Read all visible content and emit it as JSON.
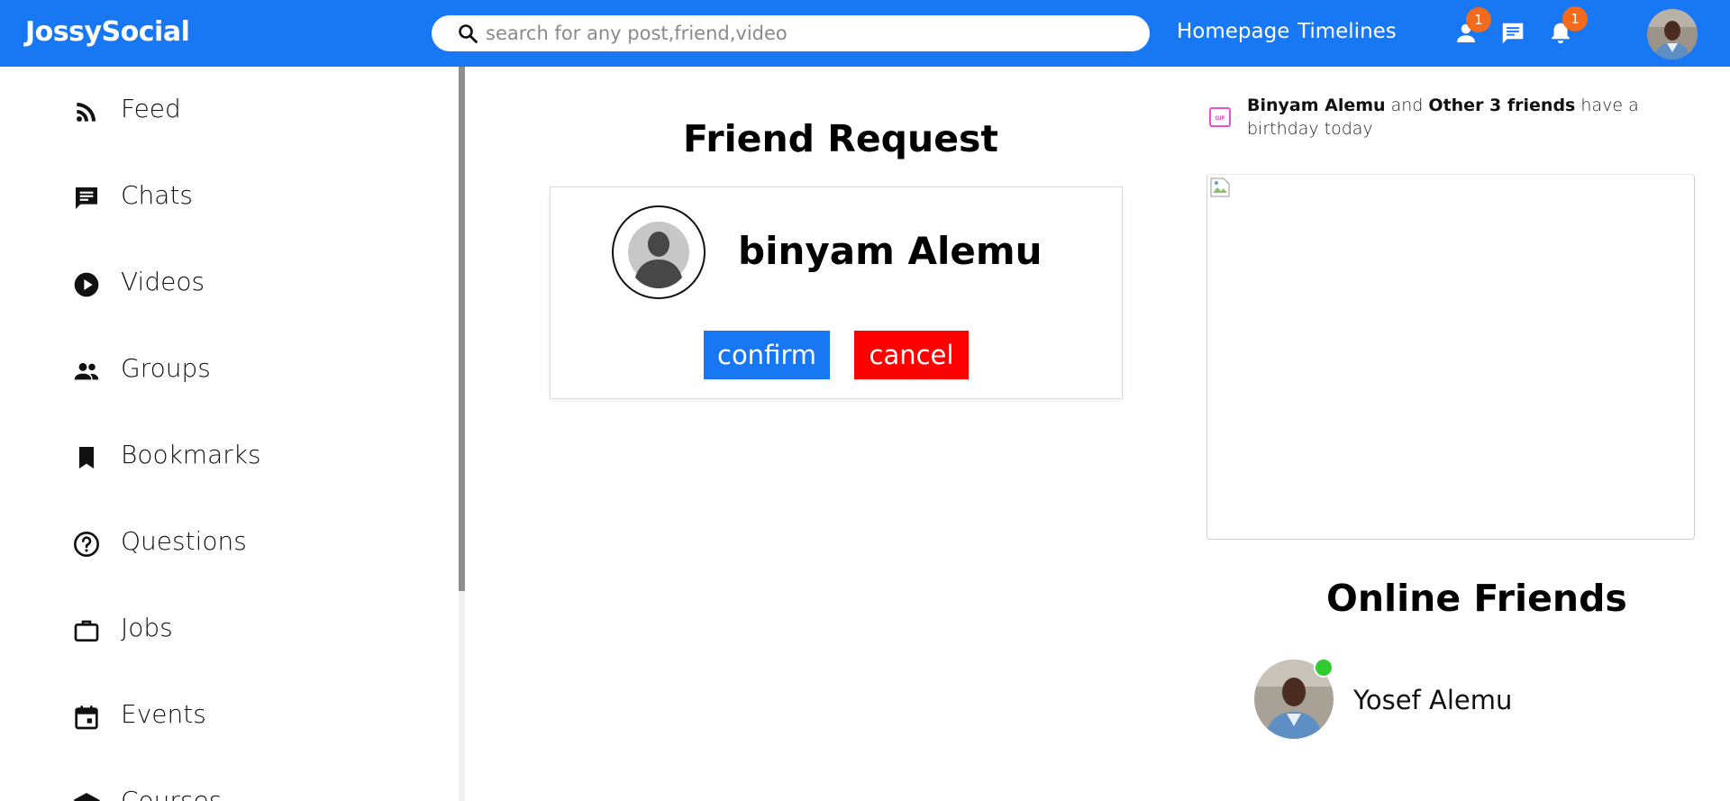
{
  "header": {
    "logo": "JossySocial",
    "search_placeholder": "search for any post,friend,video",
    "links": [
      "Homepage",
      "Timelines"
    ],
    "friend_badge": "1",
    "notification_badge": "1"
  },
  "sidebar": {
    "items": [
      {
        "label": "Feed",
        "icon": "rss-icon"
      },
      {
        "label": "Chats",
        "icon": "chat-icon"
      },
      {
        "label": "Videos",
        "icon": "play-circle-icon"
      },
      {
        "label": "Groups",
        "icon": "group-icon"
      },
      {
        "label": "Bookmarks",
        "icon": "bookmark-icon"
      },
      {
        "label": "Questions",
        "icon": "help-circle-icon"
      },
      {
        "label": "Jobs",
        "icon": "briefcase-icon"
      },
      {
        "label": "Events",
        "icon": "calendar-icon"
      },
      {
        "label": "Courses",
        "icon": "school-icon"
      }
    ]
  },
  "friend_request": {
    "title": "Friend Request",
    "name": "binyam Alemu",
    "confirm_label": "confirm",
    "cancel_label": "cancel"
  },
  "birthday": {
    "name": "Binyam Alemu",
    "and": "and",
    "others": "Other 3 friends",
    "suffix": "have a birthday today"
  },
  "online": {
    "title": "Online Friends",
    "friends": [
      {
        "name": "Yosef Alemu"
      }
    ]
  },
  "colors": {
    "brand": "#1877f2",
    "badge": "#f26a1b",
    "cancel": "#ff0000",
    "online": "#2ecc2e"
  }
}
